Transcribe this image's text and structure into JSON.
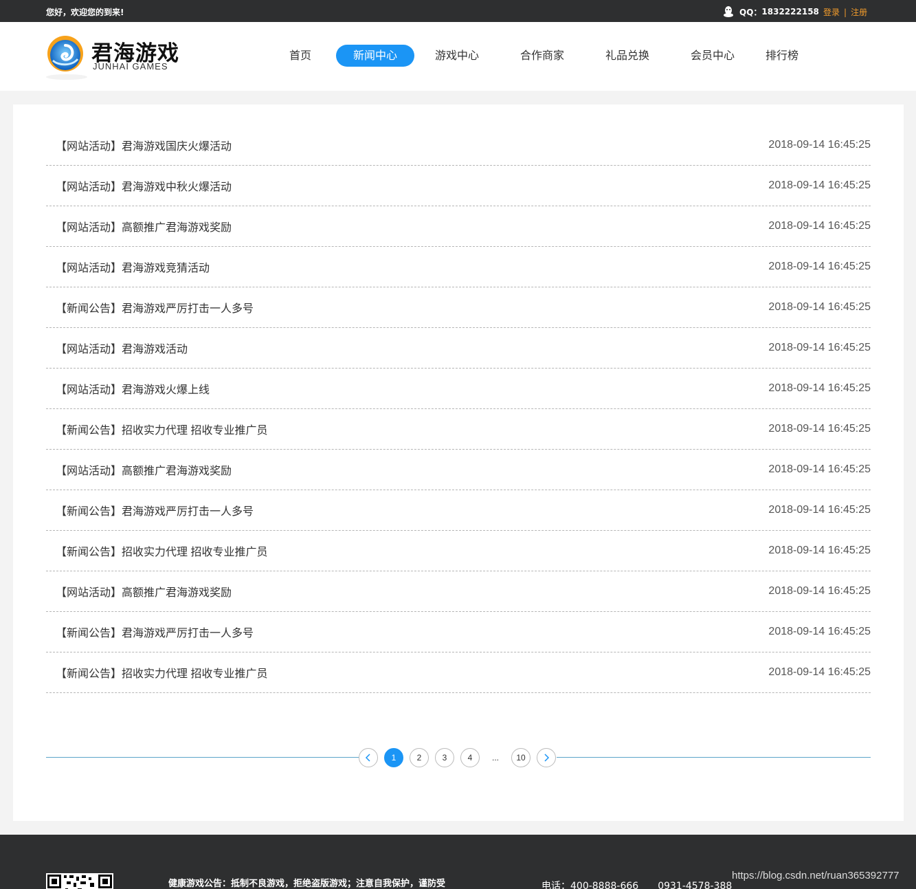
{
  "topbar": {
    "welcome": "您好，欢迎您的到来!",
    "qq_label": "QQ：",
    "qq_number": "1832222158",
    "login": "登录",
    "separator": "|",
    "register": "注册"
  },
  "logo": {
    "cn": "君海游戏",
    "en": "JUNHAI GAMES"
  },
  "nav": [
    {
      "label": "首页",
      "active": false
    },
    {
      "label": "新闻中心",
      "active": true
    },
    {
      "label": "游戏中心",
      "active": false
    },
    {
      "label": "合作商家",
      "active": false
    },
    {
      "label": "礼品兑换",
      "active": false
    },
    {
      "label": "会员中心",
      "active": false
    },
    {
      "label": "排行榜",
      "active": false
    }
  ],
  "news": [
    {
      "title": "【网站活动】君海游戏国庆火爆活动",
      "date": "2018-09-14 16:45:25"
    },
    {
      "title": "【网站活动】君海游戏中秋火爆活动",
      "date": "2018-09-14 16:45:25"
    },
    {
      "title": "【网站活动】高额推广君海游戏奖励",
      "date": "2018-09-14 16:45:25"
    },
    {
      "title": "【网站活动】君海游戏竞猜活动",
      "date": "2018-09-14 16:45:25"
    },
    {
      "title": "【新闻公告】君海游戏严厉打击一人多号",
      "date": "2018-09-14 16:45:25"
    },
    {
      "title": "【网站活动】君海游戏活动",
      "date": "2018-09-14 16:45:25"
    },
    {
      "title": "【网站活动】君海游戏火爆上线",
      "date": "2018-09-14 16:45:25"
    },
    {
      "title": "【新闻公告】招收实力代理 招收专业推广员",
      "date": "2018-09-14 16:45:25"
    },
    {
      "title": "【网站活动】高额推广君海游戏奖励",
      "date": "2018-09-14 16:45:25"
    },
    {
      "title": "【新闻公告】君海游戏严厉打击一人多号",
      "date": "2018-09-14 16:45:25"
    },
    {
      "title": "【新闻公告】招收实力代理 招收专业推广员",
      "date": "2018-09-14 16:45:25"
    },
    {
      "title": "【网站活动】高额推广君海游戏奖励",
      "date": "2018-09-14 16:45:25"
    },
    {
      "title": "【新闻公告】君海游戏严厉打击一人多号",
      "date": "2018-09-14 16:45:25"
    },
    {
      "title": "【新闻公告】招收实力代理 招收专业推广员",
      "date": "2018-09-14 16:45:25"
    }
  ],
  "pagination": {
    "prev_icon": "chevron-left-icon",
    "pages": [
      "1",
      "2",
      "3",
      "4",
      "...",
      "10"
    ],
    "current": "1",
    "next_icon": "chevron-right-icon"
  },
  "footer": {
    "notice": "健康游戏公告：抵制不良游戏，拒绝盗版游戏；注意自我保护，谨防受",
    "phone_label": "电话：400-8888-666",
    "phone_2": "0931-4578-388"
  },
  "watermark": "https://blog.csdn.net/ruan365392777",
  "colors": {
    "accent": "#1b95f5",
    "topbar_bg": "#2e2f30",
    "auth_link": "#f39c2b"
  }
}
